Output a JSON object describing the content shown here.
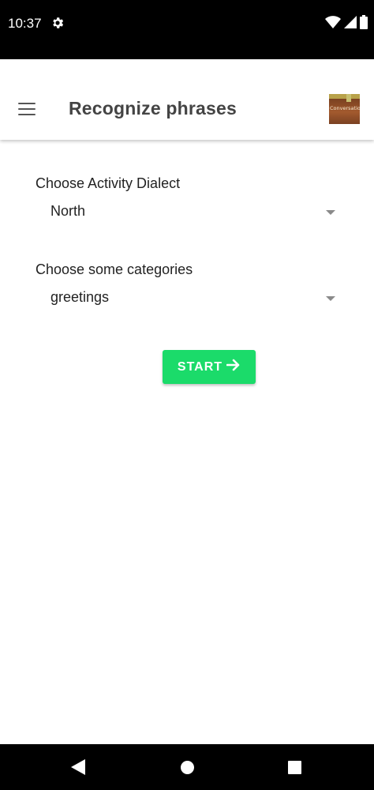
{
  "status_bar": {
    "time": "10:37",
    "icons": [
      "settings-icon",
      "wifi-icon",
      "signal-icon",
      "battery-icon"
    ]
  },
  "app_bar": {
    "title": "Recognize phrases",
    "menu_icon": "menu-icon",
    "logo_text": "Conversation"
  },
  "form": {
    "dialect": {
      "label": "Choose Activity Dialect",
      "value": "North"
    },
    "categories": {
      "label": "Choose some categories",
      "value": "greetings"
    },
    "start_button": {
      "label": "START",
      "icon": "arrow-right-icon",
      "color": "#1bdb6a"
    }
  },
  "nav_bar": {
    "icons": [
      "back-icon",
      "home-icon",
      "recents-icon"
    ]
  }
}
